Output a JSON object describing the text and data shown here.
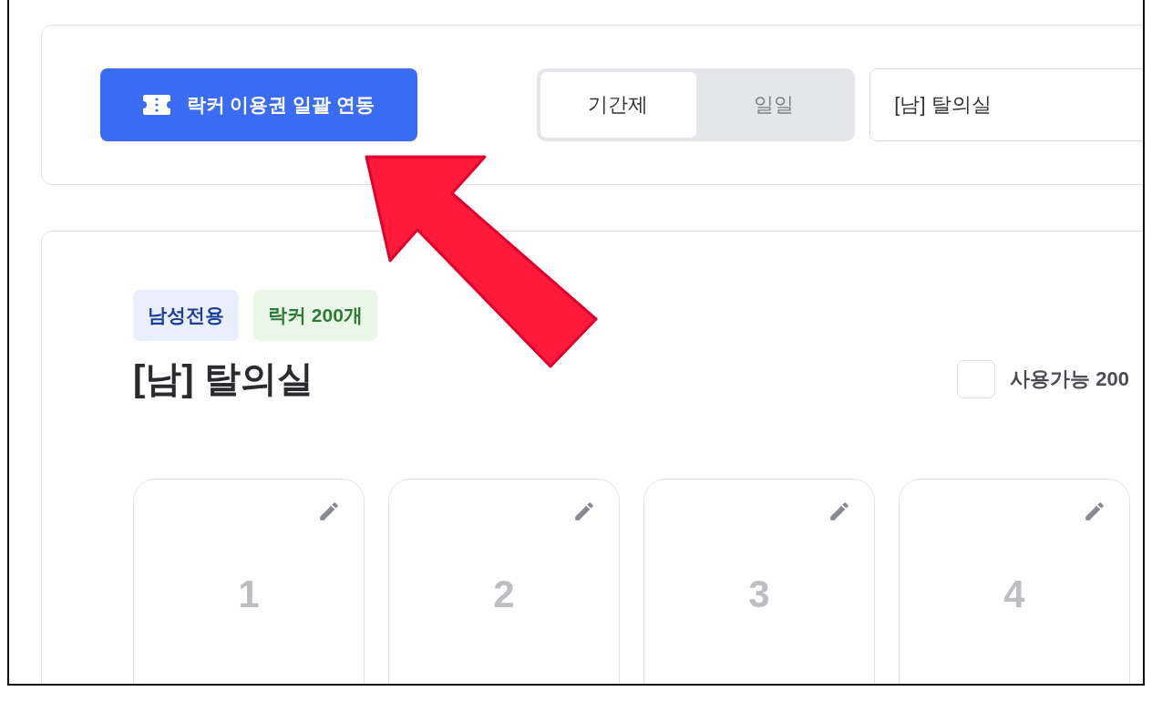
{
  "toolbar": {
    "sync_button": {
      "label": "락커 이용권 일괄 연동"
    },
    "period_tabs": [
      {
        "label": "기간제",
        "selected": true
      },
      {
        "label": "일일",
        "selected": false
      }
    ],
    "room_select": {
      "value": "[남] 탈의실"
    }
  },
  "room": {
    "badges": [
      {
        "label": "남성전용",
        "kind": "gender"
      },
      {
        "label": "락커 200개",
        "kind": "count"
      }
    ],
    "title": "[남] 탈의실",
    "available_filter": {
      "label": "사용가능 **200**",
      "checked": false
    },
    "lockers": [
      {
        "number": "1"
      },
      {
        "number": "2"
      },
      {
        "number": "3"
      },
      {
        "number": "4"
      }
    ]
  }
}
